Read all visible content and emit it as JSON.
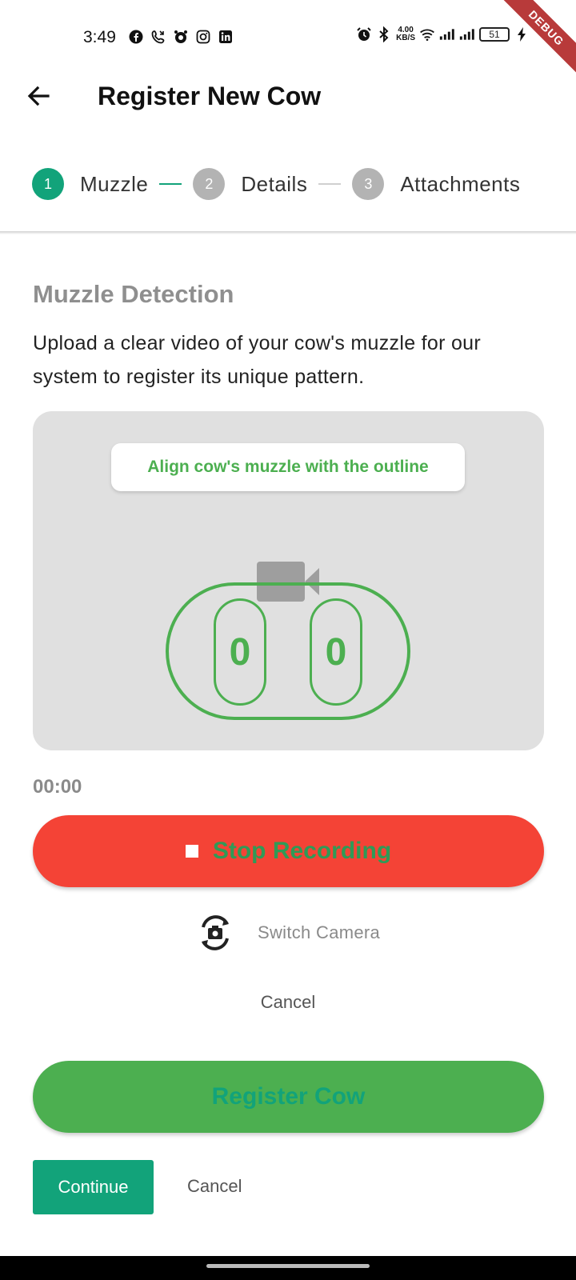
{
  "status_bar": {
    "time": "3:49",
    "speed_value": "4.00",
    "speed_unit": "KB/S",
    "battery": "51",
    "debug_label": "DEBUG"
  },
  "app_bar": {
    "title": "Register New Cow",
    "back_icon": "arrow-left-icon"
  },
  "stepper": {
    "steps": [
      {
        "number": "1",
        "label": "Muzzle",
        "active": true
      },
      {
        "number": "2",
        "label": "Details",
        "active": false
      },
      {
        "number": "3",
        "label": "Attachments",
        "active": false
      }
    ]
  },
  "content": {
    "section_title": "Muzzle Detection",
    "description": "Upload a clear video of your cow's muzzle for our system to register its unique pattern.",
    "hint": "Align cow's muzzle with the outline",
    "nostril_left": "0",
    "nostril_right": "0",
    "timer": "00:00",
    "stop_label": "Stop Recording",
    "switch_camera_label": "Switch Camera",
    "cancel_label": "Cancel",
    "register_label": "Register Cow"
  },
  "footer": {
    "continue_label": "Continue",
    "cancel_label": "Cancel"
  },
  "colors": {
    "accent": "#12a37a",
    "green": "#4caf50",
    "red": "#f44336"
  }
}
